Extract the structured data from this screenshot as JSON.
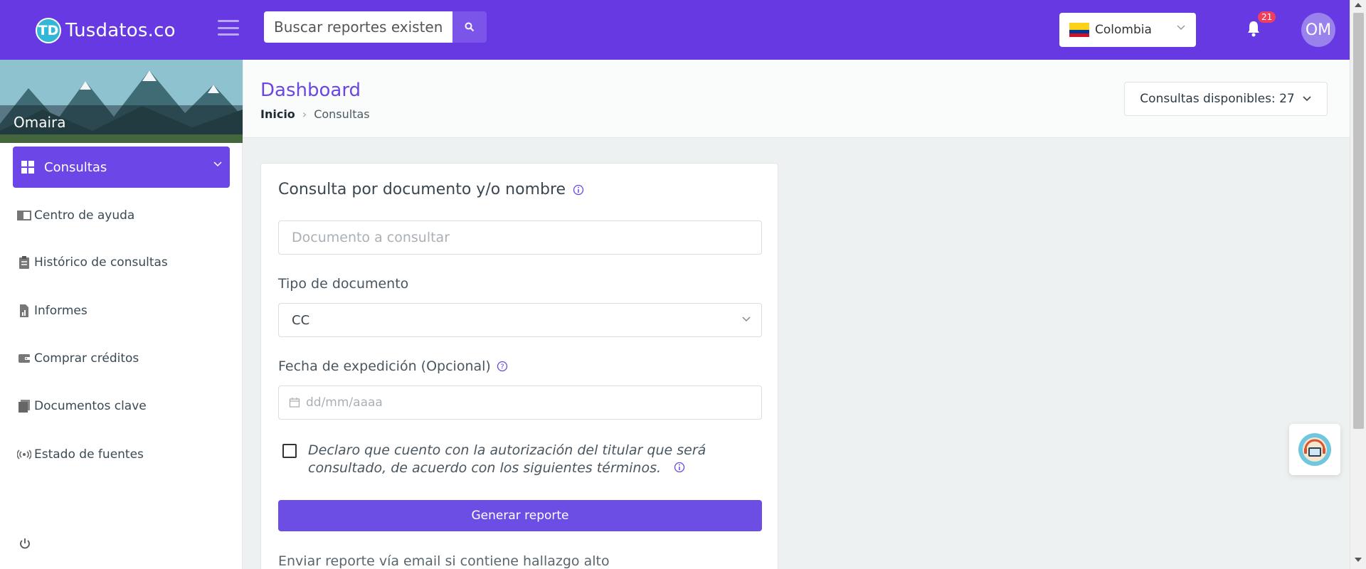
{
  "topbar": {
    "brand_logo": "TD",
    "brand_name": "Tusdatos.co",
    "search_placeholder": "Buscar reportes existentes",
    "country": "Colombia",
    "notifications_count": "21",
    "avatar_initials": "OM"
  },
  "sidebar": {
    "user_name": "Omaira",
    "active_item": "Consultas",
    "items": [
      {
        "label": "Centro de ayuda",
        "icon": "book-icon"
      },
      {
        "label": "Histórico de consultas",
        "icon": "clipboard-icon"
      },
      {
        "label": "Informes",
        "icon": "report-icon"
      },
      {
        "label": "Comprar créditos",
        "icon": "wallet-icon"
      },
      {
        "label": "Documentos clave",
        "icon": "documents-icon"
      },
      {
        "label": "Estado de fuentes",
        "icon": "broadcast-icon"
      }
    ]
  },
  "header": {
    "title": "Dashboard",
    "breadcrumb_home": "Inicio",
    "breadcrumb_current": "Consultas",
    "credits_label": "Consultas disponibles: 27"
  },
  "form": {
    "title": "Consulta por documento y/o nombre",
    "document_placeholder": "Documento a consultar",
    "doc_type_label": "Tipo de documento",
    "doc_type_value": "CC",
    "date_label": "Fecha de expedición (Opcional)",
    "date_placeholder": "dd/mm/aaaa",
    "consent_text": "Declaro que cuento con la autorización del titular que será consultado, de acuerdo con los siguientes términos.",
    "submit_label": "Generar reporte",
    "email_option_text": "Enviar reporte vía email si contiene hallazgo alto"
  },
  "colors": {
    "primary": "#6739e3",
    "button": "#6c4ee4",
    "badge": "#ef3f5d"
  }
}
